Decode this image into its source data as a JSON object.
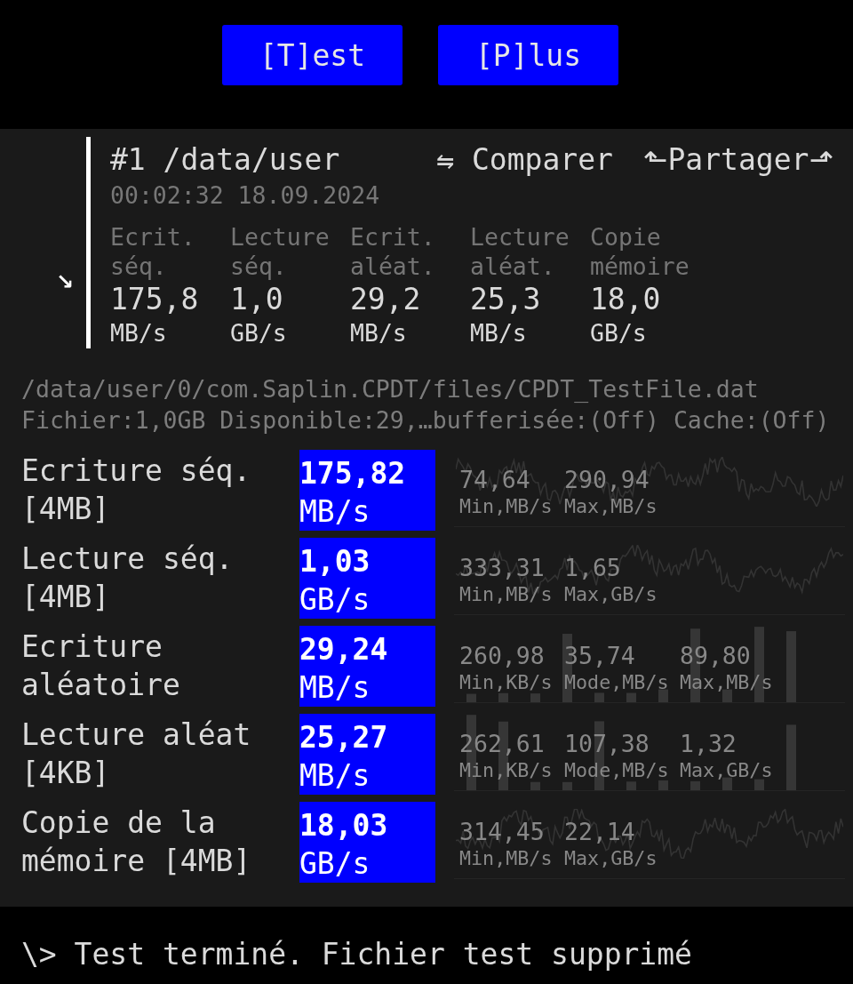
{
  "toolbar": {
    "buttons": [
      {
        "label": "[T]est"
      },
      {
        "label": "[P]lus"
      }
    ]
  },
  "result": {
    "toggle": "↘",
    "title": "#1 /data/user",
    "actions": [
      {
        "label": "⇋ Comparer"
      },
      {
        "label": "⬑Partager⬏"
      }
    ],
    "timestamp": "00:02:32 18.09.2024",
    "summary": [
      {
        "label": "Ecrit. séq.",
        "value": "175,8",
        "unit": "MB/s"
      },
      {
        "label": "Lecture séq.",
        "value": "1,0",
        "unit": "GB/s"
      },
      {
        "label": "Ecrit. aléat.",
        "value": "29,2",
        "unit": "MB/s"
      },
      {
        "label": "Lecture aléat.",
        "value": "25,3",
        "unit": "MB/s"
      },
      {
        "label": "Copie mémoire",
        "value": "18,0",
        "unit": "GB/s"
      }
    ]
  },
  "file": {
    "path": "/data/user/0/com.Saplin.CPDT/files/CPDT_TestFile.dat",
    "info": "Fichier:1,0GB Disponible:29,…bufferisée:(Off) Cache:(Off)"
  },
  "tests": [
    {
      "label": "Ecriture séq. [4MB]",
      "value": "175,82",
      "unit": "MB/s",
      "kind": "line",
      "stats": [
        {
          "value": "74,64",
          "unit": "Min,MB/s"
        },
        {
          "value": "290,94",
          "unit": "Max,MB/s"
        }
      ]
    },
    {
      "label": "Lecture séq. [4MB]",
      "value": "1,03",
      "unit": "GB/s",
      "kind": "line",
      "stats": [
        {
          "value": "333,31",
          "unit": "Min,MB/s"
        },
        {
          "value": "1,65",
          "unit": "Max,GB/s"
        }
      ]
    },
    {
      "label": "Ecriture aléatoire",
      "value": "29,24",
      "unit": "MB/s",
      "kind": "histogram",
      "stats": [
        {
          "value": "260,98",
          "unit": "Min,KB/s"
        },
        {
          "value": "35,74",
          "unit": "Mode,MB/s"
        },
        {
          "value": "89,80",
          "unit": "Max,MB/s"
        }
      ]
    },
    {
      "label": "Lecture aléat [4KB]",
      "value": "25,27",
      "unit": "MB/s",
      "kind": "histogram",
      "stats": [
        {
          "value": "262,61",
          "unit": "Min,KB/s"
        },
        {
          "value": "107,38",
          "unit": "Mode,MB/s"
        },
        {
          "value": "1,32",
          "unit": "Max,GB/s"
        }
      ]
    },
    {
      "label": "Copie de la mémoire [4MB]",
      "value": "18,03",
      "unit": "GB/s",
      "kind": "line",
      "stats": [
        {
          "value": "314,45",
          "unit": "Min,MB/s"
        },
        {
          "value": "22,14",
          "unit": "Max,GB/s"
        }
      ]
    }
  ],
  "status": "\\> Test terminé. Fichier test supprimé"
}
